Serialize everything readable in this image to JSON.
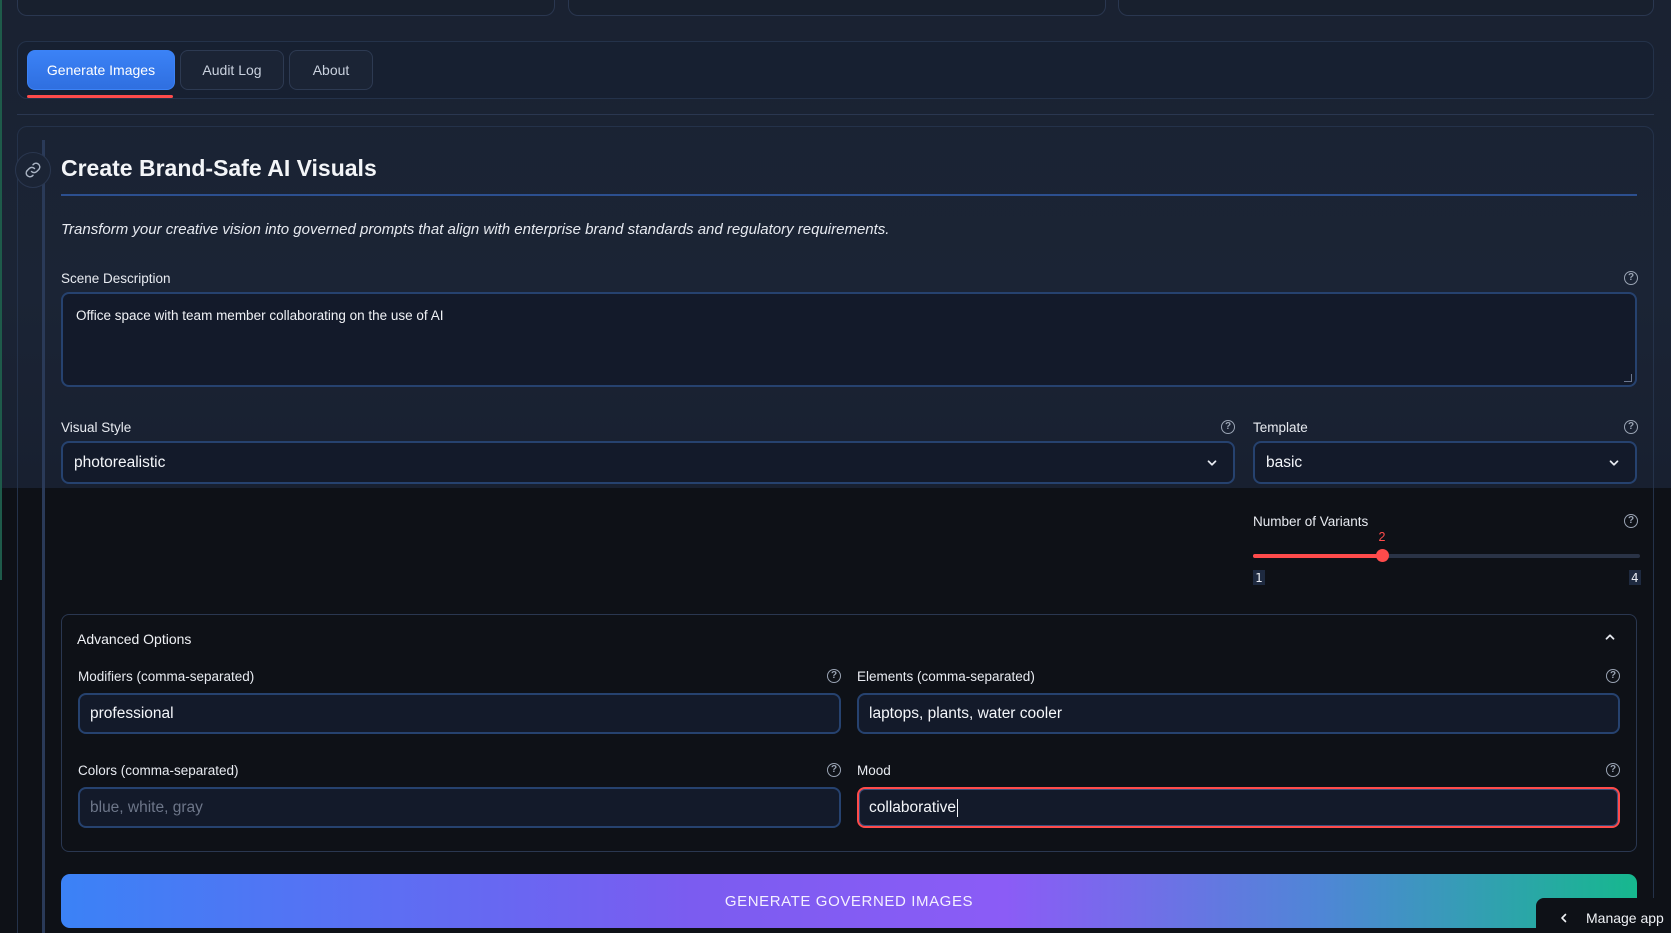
{
  "tabs": [
    {
      "label": "Generate Images",
      "active": true
    },
    {
      "label": "Audit Log",
      "active": false
    },
    {
      "label": "About",
      "active": false
    }
  ],
  "main": {
    "title": "Create Brand-Safe AI Visuals",
    "subtitle": "Transform your creative vision into governed prompts that align with enterprise brand standards and regulatory requirements."
  },
  "scene": {
    "label": "Scene Description",
    "value": "Office space with team member collaborating on the use of AI"
  },
  "visual_style": {
    "label": "Visual Style",
    "value": "photorealistic"
  },
  "template": {
    "label": "Template",
    "value": "basic"
  },
  "variants": {
    "label": "Number of Variants",
    "value": 2,
    "min": 1,
    "max": 4,
    "value_label": "2",
    "min_label": "1",
    "max_label": "4"
  },
  "advanced": {
    "title": "Advanced Options",
    "modifiers": {
      "label": "Modifiers (comma-separated)",
      "value": "professional"
    },
    "elements": {
      "label": "Elements (comma-separated)",
      "value": "laptops, plants, water cooler"
    },
    "colors": {
      "label": "Colors (comma-separated)",
      "value": "",
      "placeholder": "blue, white, gray"
    },
    "mood": {
      "label": "Mood",
      "value": "collaborative"
    }
  },
  "generate_button": "GENERATE GOVERNED IMAGES",
  "manage_app": "Manage app",
  "help_glyph": "?",
  "colors": {
    "accent": "#3b82f6",
    "danger": "#ff4b4b",
    "teal": "#16b88e",
    "violet": "#8b5cf6"
  }
}
